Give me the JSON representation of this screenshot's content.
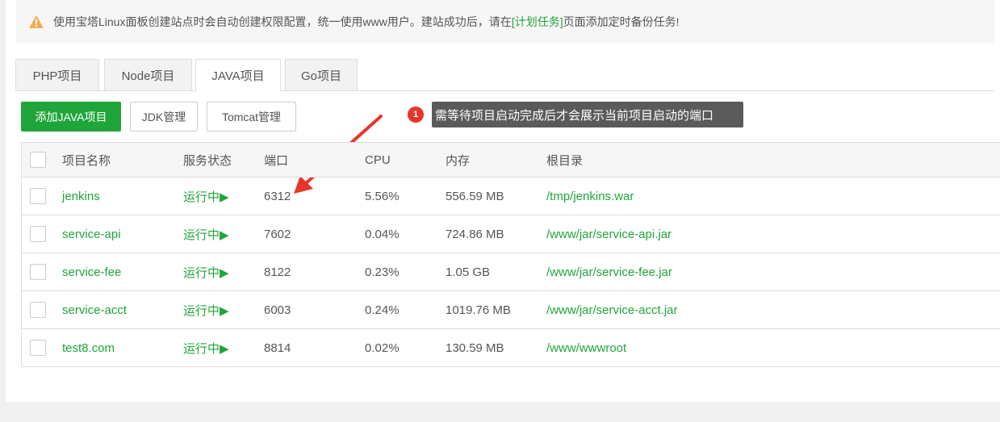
{
  "notice": {
    "text_before": "使用宝塔Linux面板创建站点时会自动创建权限配置，统一使用www用户。建站成功后，请在",
    "link": "[计划任务]",
    "text_after": "页面添加定时备份任务!"
  },
  "tabs": [
    {
      "label": "PHP项目"
    },
    {
      "label": "Node项目"
    },
    {
      "label": "JAVA项目"
    },
    {
      "label": "Go项目"
    }
  ],
  "toolbar": {
    "add_label": "添加JAVA项目",
    "jdk_label": "JDK管理",
    "tomcat_label": "Tomcat管理"
  },
  "annotation": {
    "badge": "1",
    "tip": "需等待项目启动完成后才会展示当前项目启动的端口"
  },
  "table": {
    "headers": {
      "name": "项目名称",
      "status": "服务状态",
      "port": "端口",
      "cpu": "CPU",
      "mem": "内存",
      "root": "根目录"
    },
    "rows": [
      {
        "name": "jenkins",
        "status": "运行中▶",
        "port": "6312",
        "cpu": "5.56%",
        "mem": "556.59 MB",
        "root": "/tmp/jenkins.war"
      },
      {
        "name": "service-api",
        "status": "运行中▶",
        "port": "7602",
        "cpu": "0.04%",
        "mem": "724.86 MB",
        "root": "/www/jar/service-api.jar"
      },
      {
        "name": "service-fee",
        "status": "运行中▶",
        "port": "8122",
        "cpu": "0.23%",
        "mem": "1.05 GB",
        "root": "/www/jar/service-fee.jar"
      },
      {
        "name": "service-acct",
        "status": "运行中▶",
        "port": "6003",
        "cpu": "0.24%",
        "mem": "1019.76 MB",
        "root": "/www/jar/service-acct.jar"
      },
      {
        "name": "test8.com",
        "status": "运行中▶",
        "port": "8814",
        "cpu": "0.02%",
        "mem": "130.59 MB",
        "root": "/www/wwwroot"
      }
    ]
  },
  "colors": {
    "accent": "#20a53a",
    "warning": "#f0ad4e",
    "annotation_red": "#e7352c",
    "tooltip_bg": "#5a5a5a"
  },
  "icons": {
    "warning": "warning-triangle-icon",
    "arrow": "annotation-arrow"
  }
}
